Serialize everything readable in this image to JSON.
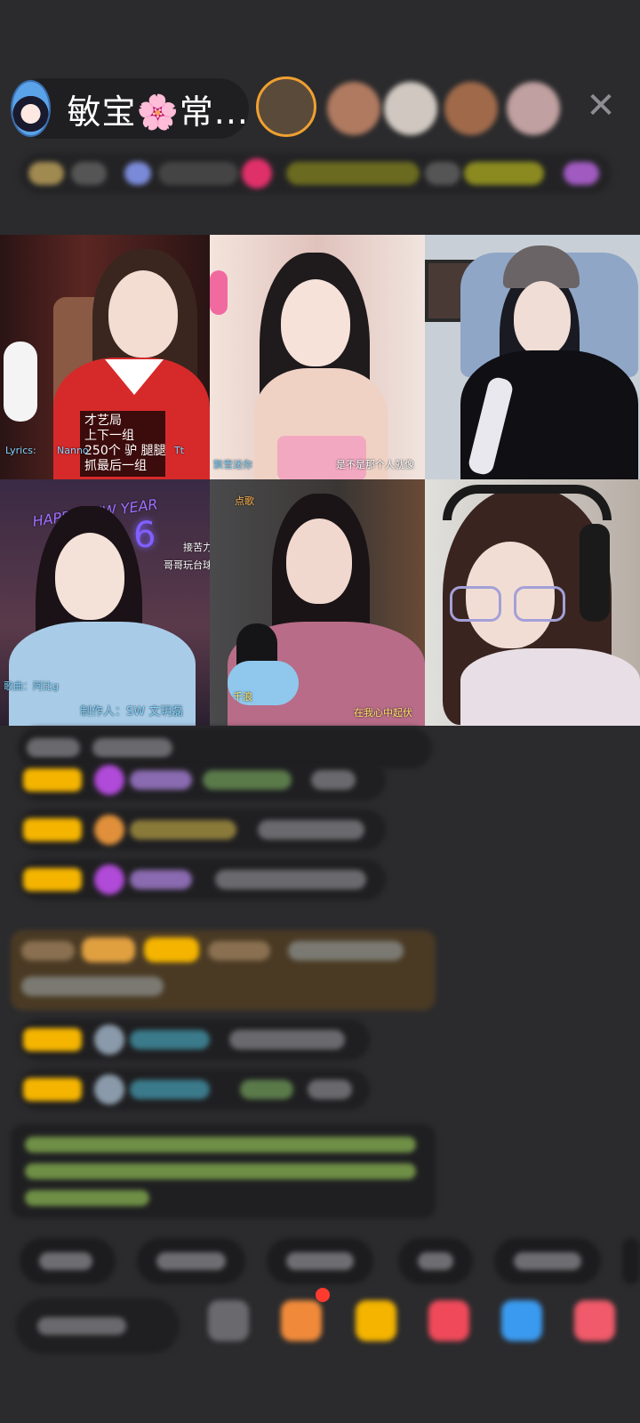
{
  "header": {
    "host_name": "敏宝🌸常...",
    "close_icon": "close-icon",
    "viewer_avatar_colors": [
      "#e89a2a",
      "#b07a60",
      "#d0c8c0",
      "#a06a4a",
      "#c0a0a0"
    ]
  },
  "tiles": [
    {
      "name": "tile-1",
      "bg": "#5a2622",
      "captions": [
        "Lyrics: ",
        "Nanno",
        "Tt"
      ],
      "note_box": [
        "才艺局",
        "上下一组",
        "250个 驴 腿腿",
        "抓最后一组"
      ]
    },
    {
      "name": "tile-2",
      "bg": "#e9d6cf",
      "captions": [
        "飘雪迷你",
        "是不是那个人就像"
      ]
    },
    {
      "name": "tile-3",
      "bg": "#c9cfd6",
      "captions": []
    },
    {
      "name": "tile-4",
      "bg": "#3c2a44",
      "captions": [
        "HAPPY NEW YEAR",
        "6",
        "接苦力",
        "哥哥玩台球",
        "歌曲：阿比g",
        "制作人：SW 文玥磊"
      ]
    },
    {
      "name": "tile-5",
      "bg": "#3a3634",
      "captions": [
        "点歌",
        "千浪",
        "在我心中起伏"
      ]
    },
    {
      "name": "tile-6",
      "bg": "#bfb7b0",
      "captions": []
    }
  ],
  "colors": {
    "badge": "#f4b400",
    "purple_gem": "#b04ad8",
    "gift_card": "#4a3a24",
    "sys_text": "#6f8f46"
  }
}
